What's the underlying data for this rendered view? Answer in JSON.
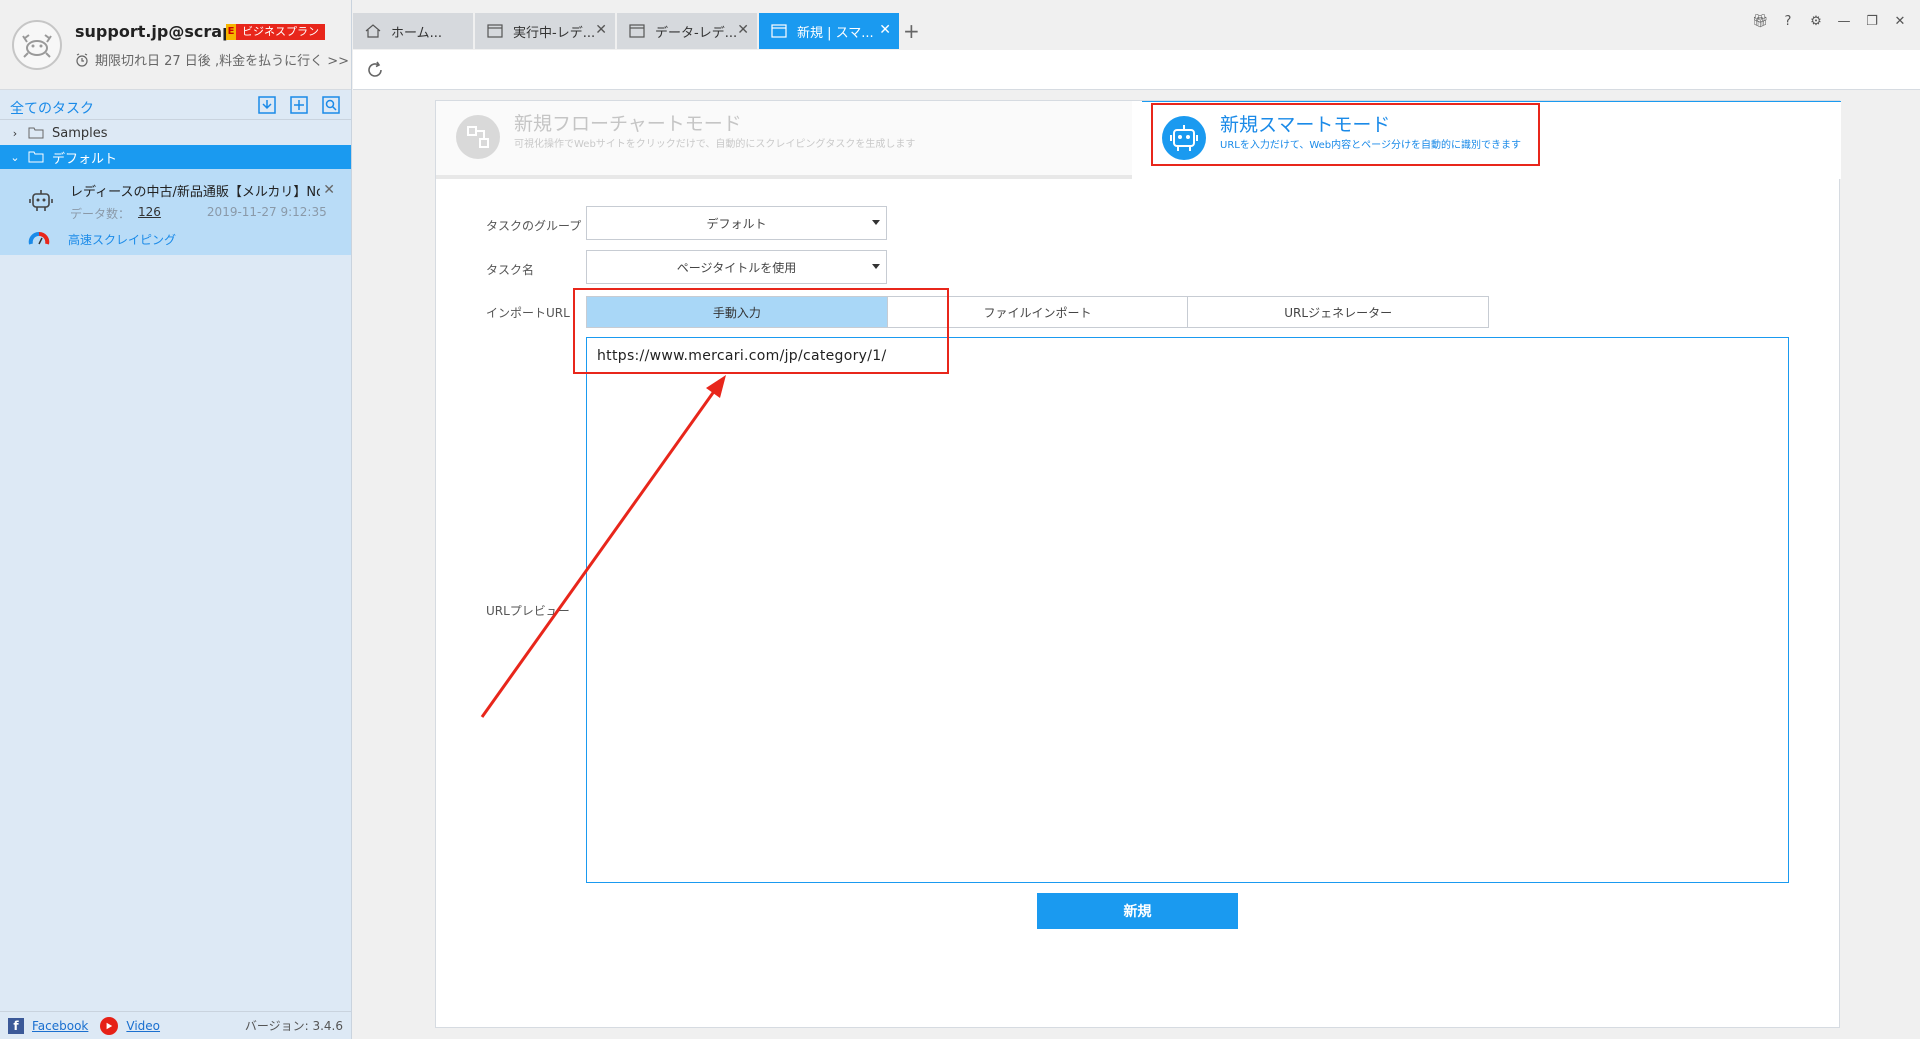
{
  "profile": {
    "email": "support.jp@scrap...",
    "plan_letter": "E",
    "plan_badge": "ビジネスプラン",
    "expire_text": "期限切れ日 27 日後 ,料金を払うに行く >>"
  },
  "sidebar": {
    "all_tasks_label": "全てのタスク",
    "folders": [
      {
        "label": "Samples"
      },
      {
        "label": "デフォルト"
      }
    ],
    "task": {
      "name": "レディースの中古/新品通販【メルカリ】No...",
      "data_count_label": "データ数：",
      "data_count": "126",
      "date": "2019-11-27 9:12:35",
      "mode": "高速スクレイピング"
    },
    "footer": {
      "facebook": "Facebook",
      "video": "Video",
      "version": "バージョン: 3.4.6"
    }
  },
  "tabs": [
    {
      "label": "ホーム..."
    },
    {
      "label": "実行中-レデ..."
    },
    {
      "label": "データ-レデ..."
    },
    {
      "label": "新規 | スマ..."
    }
  ],
  "modes": {
    "flow": {
      "title": "新規フローチャートモード",
      "subtitle": "可視化操作でWebサイトをクリックだけで、自動的にスクレイピングタスクを生成します"
    },
    "smart": {
      "title": "新規スマートモード",
      "subtitle": "URLを入力だけて、Web内容とページ分けを自動的に識別できます"
    }
  },
  "form": {
    "group_label": "タスクのグループ",
    "group_value": "デフォルト",
    "name_label": "タスク名",
    "name_value": "ページタイトルを使用",
    "import_label": "インポートURL",
    "url_tabs": [
      "手動入力",
      "ファイルインポート",
      "URLジェネレーター"
    ],
    "url_value": "https://www.mercari.com/jp/category/1/",
    "preview_label": "URLプレビュー",
    "create_button": "新規"
  },
  "colors": {
    "accent": "#1a9af0",
    "annotation": "#e8261b",
    "sidebar_bg": "#dde9f5"
  }
}
